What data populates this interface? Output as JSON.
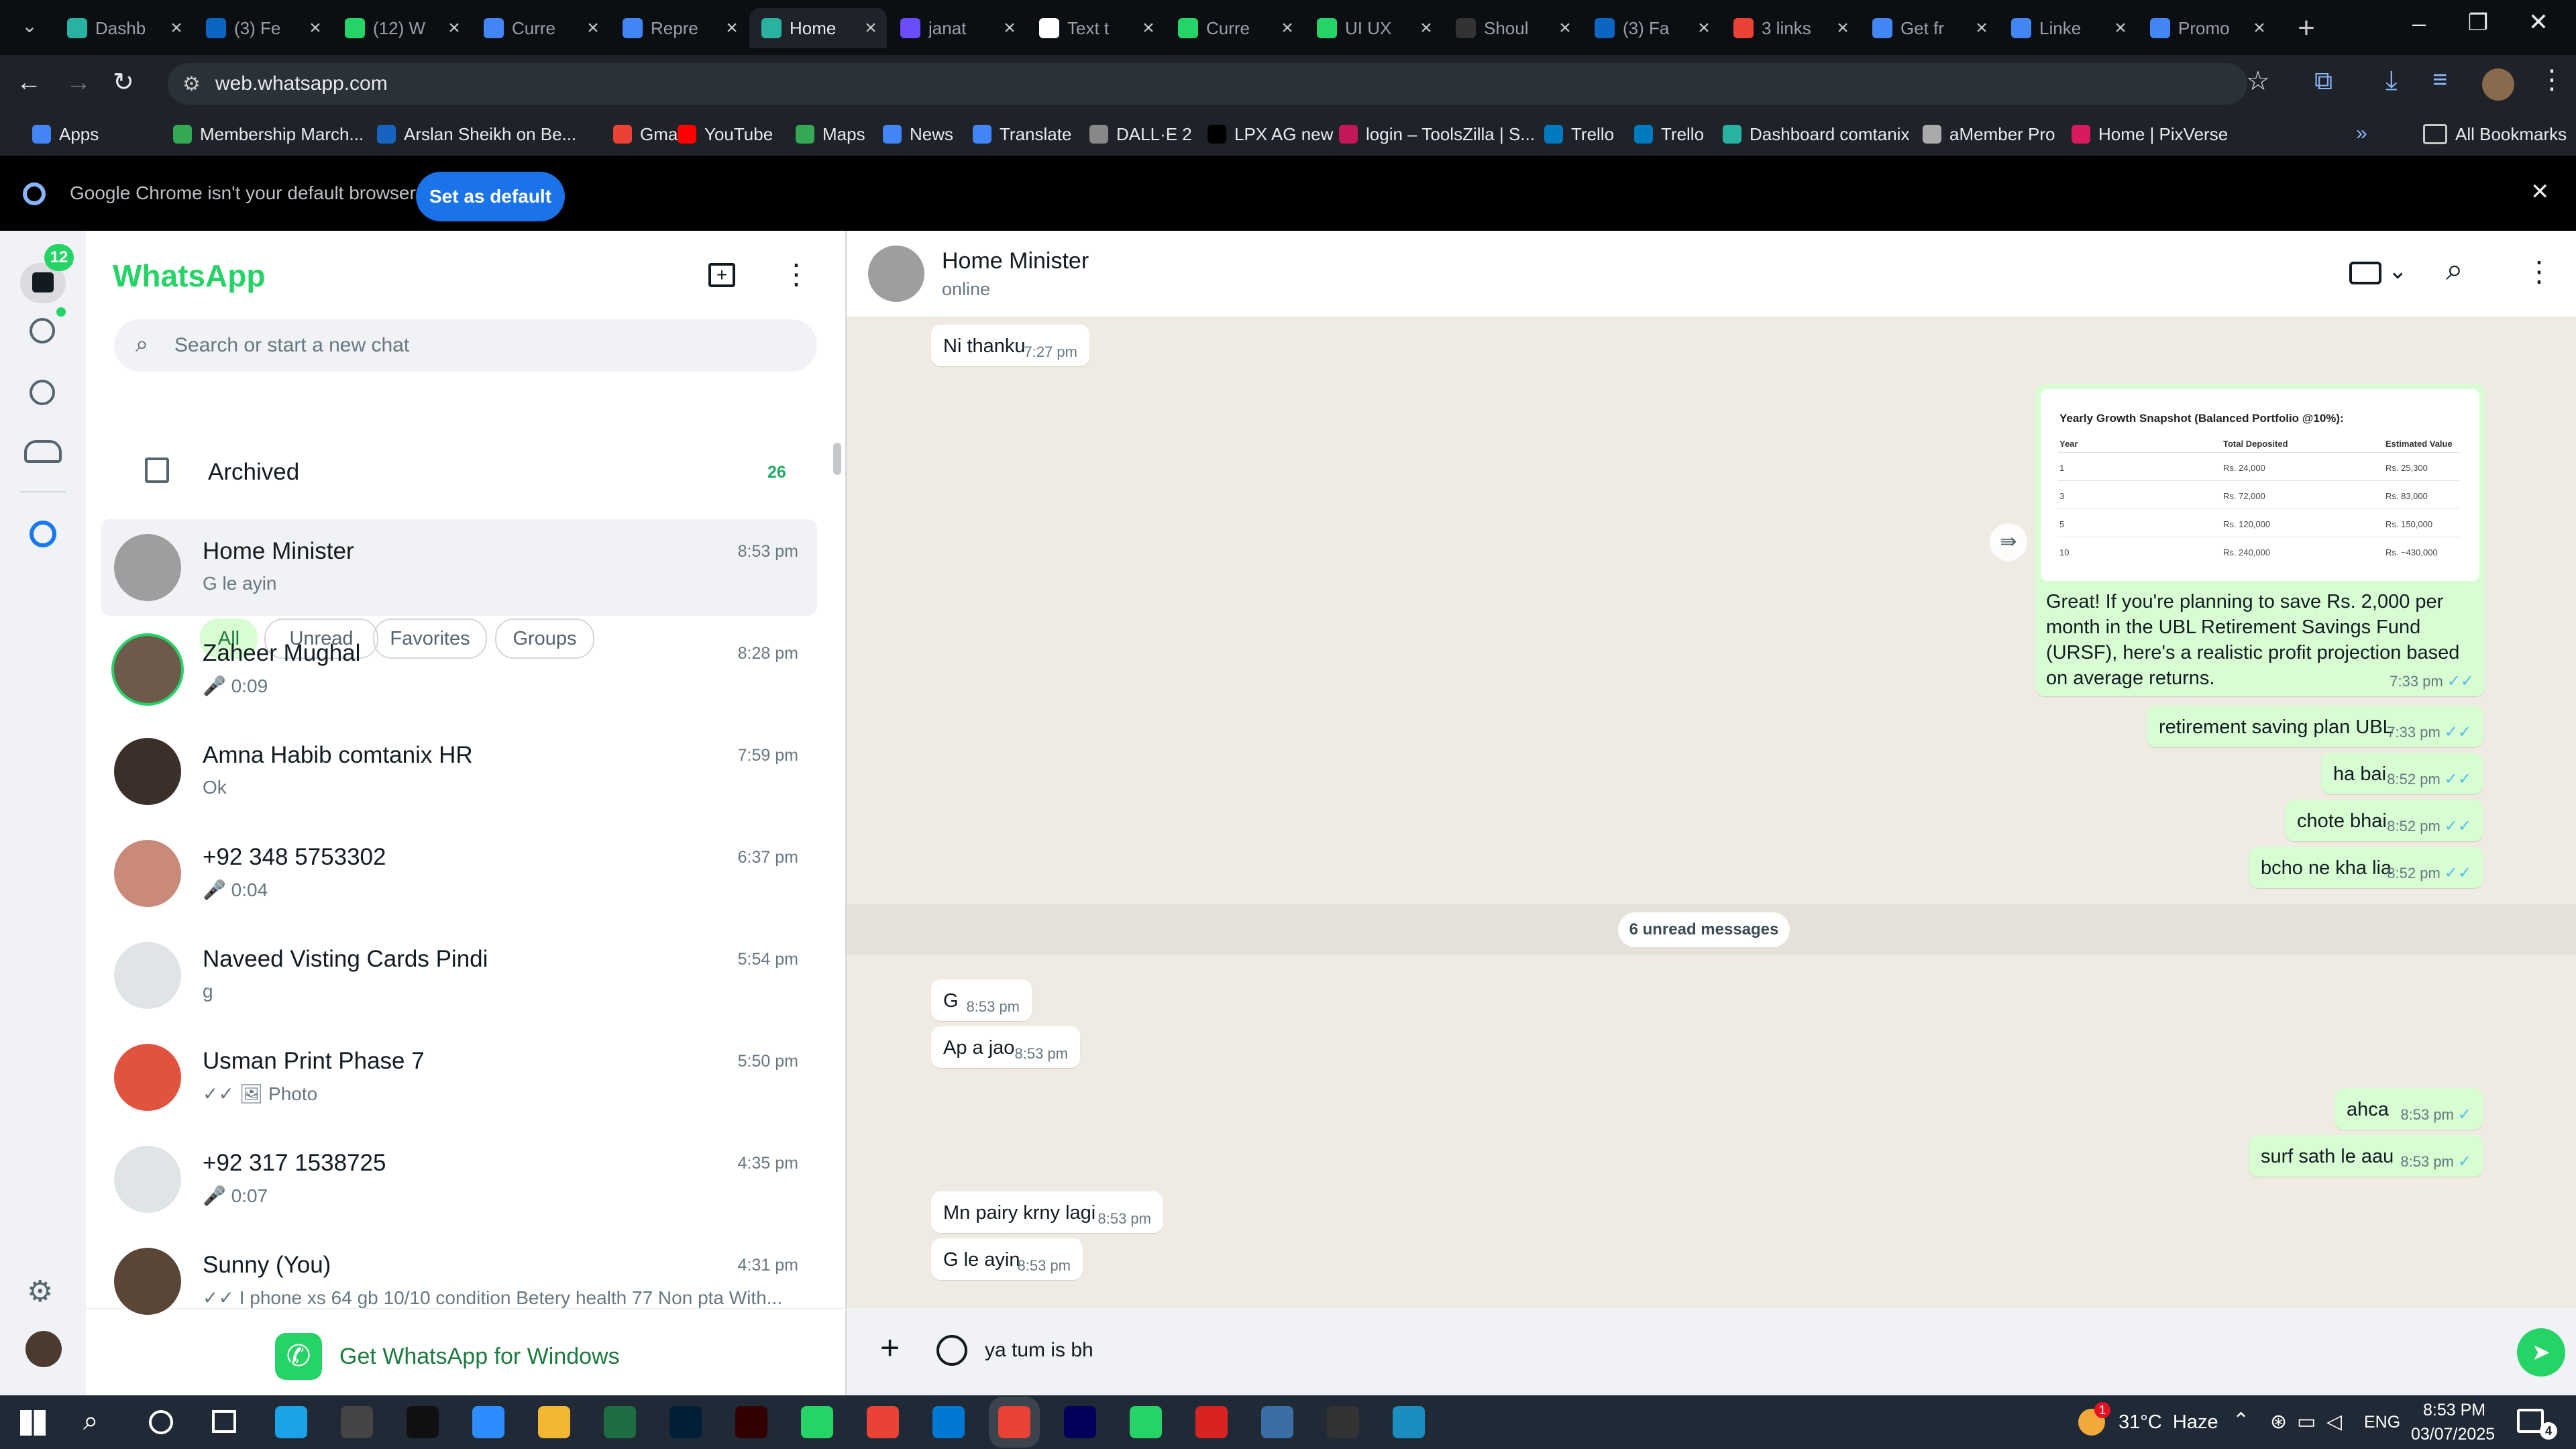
{
  "browser": {
    "tabs": [
      {
        "title": "Dashb",
        "color": "#2ab2a0"
      },
      {
        "title": "(3) Fe",
        "color": "#0a66c2"
      },
      {
        "title": "(12) W",
        "color": "#25d366"
      },
      {
        "title": "Curre",
        "color": "#4285f4"
      },
      {
        "title": "Repre",
        "color": "#4285f4"
      },
      {
        "title": "Home",
        "color": "#2ab2a0"
      },
      {
        "title": "janat",
        "color": "#6c4cff"
      },
      {
        "title": "Text t",
        "color": "#ffffff"
      },
      {
        "title": "Curre",
        "color": "#25d366"
      },
      {
        "title": "UI UX",
        "color": "#25d366"
      },
      {
        "title": "Shoul",
        "color": "#333333"
      },
      {
        "title": "(3) Fa",
        "color": "#0a66c2"
      },
      {
        "title": "3 links",
        "color": "#ea4335"
      },
      {
        "title": "Get fr",
        "color": "#4285f4"
      },
      {
        "title": "Linke",
        "color": "#4285f4"
      },
      {
        "title": "Promo",
        "color": "#4285f4"
      }
    ],
    "url": "web.whatsapp.com",
    "bookmarks": [
      {
        "label": "Apps",
        "color": "#4285f4"
      },
      {
        "label": "Membership March...",
        "color": "#34a853"
      },
      {
        "label": "Arslan Sheikh on Be...",
        "color": "#1565c0"
      },
      {
        "label": "Gmail",
        "color": "#ea4335"
      },
      {
        "label": "YouTube",
        "color": "#ff0000"
      },
      {
        "label": "Maps",
        "color": "#34a853"
      },
      {
        "label": "News",
        "color": "#4285f4"
      },
      {
        "label": "Translate",
        "color": "#4285f4"
      },
      {
        "label": "DALL·E 2",
        "color": "#888888"
      },
      {
        "label": "LPX AG new",
        "color": "#000000"
      },
      {
        "label": "login – ToolsZilla | S...",
        "color": "#c2185b"
      },
      {
        "label": "Trello",
        "color": "#0079bf"
      },
      {
        "label": "Trello",
        "color": "#0079bf"
      },
      {
        "label": "Dashboard comtanix",
        "color": "#2ab2a0"
      },
      {
        "label": "aMember Pro",
        "color": "#aaaaaa"
      },
      {
        "label": "Home | PixVerse",
        "color": "#d81b60"
      }
    ],
    "all_bookmarks": "All Bookmarks",
    "infobar_text": "Google Chrome isn't your default browser",
    "set_default": "Set as default"
  },
  "rail": {
    "badge": "12"
  },
  "sidebar": {
    "title": "WhatsApp",
    "search_placeholder": "Search or start a new chat",
    "filters": [
      "All",
      "Unread",
      "Favorites",
      "Groups"
    ],
    "archived_label": "Archived",
    "archived_count": "26",
    "chats": [
      {
        "name": "Home Minister",
        "preview": "G le ayin",
        "time": "8:53 pm",
        "avatar": "#9e9e9e"
      },
      {
        "name": "Zaheer Mughal",
        "preview": "🎤 0:09",
        "time": "8:28 pm",
        "avatar": "#6d5a4a"
      },
      {
        "name": "Amna Habib comtanix HR",
        "preview": "Ok",
        "time": "7:59 pm",
        "avatar": "#3b2f2a"
      },
      {
        "name": "+92 348 5753302",
        "preview": "🎤 0:04",
        "time": "6:37 pm",
        "avatar": "#c98a7a"
      },
      {
        "name": "Naveed Visting Cards Pindi",
        "preview": "g",
        "time": "5:54 pm",
        "avatar": "#dfe5e7"
      },
      {
        "name": "Usman Print Phase 7",
        "preview": "✓✓ 🖼 Photo",
        "time": "5:50 pm",
        "avatar": "#e0533e"
      },
      {
        "name": "+92 317 1538725",
        "preview": "🎤 0:07",
        "time": "4:35 pm",
        "avatar": "#dfe5e7"
      },
      {
        "name": "Sunny (You)",
        "preview": "✓✓ I phone xs  64 gb 10/10 condition Betery health 77 Non pta With...",
        "time": "4:31 pm",
        "avatar": "#5a4636"
      }
    ],
    "promo": "Get WhatsApp for Windows"
  },
  "conversation": {
    "contact_name": "Home Minister",
    "status": "online",
    "image_card": {
      "title": "Yearly Growth Snapshot (Balanced Portfolio @10%):",
      "headers": [
        "Year",
        "Total Deposited",
        "Estimated Value"
      ],
      "rows": [
        [
          "1",
          "Rs. 24,000",
          "Rs. 25,300"
        ],
        [
          "3",
          "Rs. 72,000",
          "Rs. 83,000"
        ],
        [
          "5",
          "Rs. 120,000",
          "Rs. 150,000"
        ],
        [
          "10",
          "Rs. 240,000",
          "Rs. ~430,000"
        ]
      ]
    },
    "messages": [
      {
        "dir": "in",
        "text": "Ni thanku",
        "time": "7:27 pm"
      },
      {
        "dir": "out",
        "text": "Great! If you're planning to save Rs. 2,000 per month in the UBL Retirement Savings Fund (URSF), here's a realistic profit projection based on average returns.",
        "time": "7:33 pm"
      },
      {
        "dir": "out",
        "text": "retirement saving plan UBL",
        "time": "7:33 pm"
      },
      {
        "dir": "out",
        "text": "ha bai",
        "time": "8:52 pm"
      },
      {
        "dir": "out",
        "text": "chote bhai",
        "time": "8:52 pm"
      },
      {
        "dir": "out",
        "text": "bcho ne kha lia",
        "time": "8:52 pm"
      },
      {
        "dir": "in",
        "text": "G",
        "time": "8:53 pm"
      },
      {
        "dir": "in",
        "text": "Ap a jao",
        "time": "8:53 pm"
      },
      {
        "dir": "out",
        "text": "ahca",
        "time": "8:53 pm"
      },
      {
        "dir": "out",
        "text": "surf sath le aau",
        "time": "8:53 pm"
      },
      {
        "dir": "in",
        "text": "Mn pairy krny lagi",
        "time": "8:53 pm"
      },
      {
        "dir": "in",
        "text": "G le ayin",
        "time": "8:53 pm"
      }
    ],
    "unread_divider": "6 unread messages",
    "composer_value": "ya tum is bh"
  },
  "taskbar": {
    "weather": "31°C  Haze",
    "weather_badge": "1",
    "lang": "ENG",
    "time": "8:53 PM",
    "date": "03/07/2025",
    "notif_count": "4",
    "apps": [
      {
        "name": "edge",
        "color": "#1aa3e8"
      },
      {
        "name": "pen",
        "color": "#444444"
      },
      {
        "name": "terminal",
        "color": "#111111"
      },
      {
        "name": "zoom",
        "color": "#2d8cff"
      },
      {
        "name": "explorer",
        "color": "#f2b632"
      },
      {
        "name": "excel",
        "color": "#1d6f42"
      },
      {
        "name": "photoshop",
        "color": "#001e36"
      },
      {
        "name": "illustrator",
        "color": "#330000"
      },
      {
        "name": "phone",
        "color": "#25d366"
      },
      {
        "name": "chrome",
        "color": "#ea4335"
      },
      {
        "name": "vscode",
        "color": "#0078d4"
      },
      {
        "name": "chrome-active",
        "color": "#ea4335"
      },
      {
        "name": "premiere",
        "color": "#00005b"
      },
      {
        "name": "phone2",
        "color": "#25d366"
      },
      {
        "name": "acrobat",
        "color": "#d92323"
      },
      {
        "name": "calculator",
        "color": "#3a6ea5"
      },
      {
        "name": "media",
        "color": "#333333"
      },
      {
        "name": "app",
        "color": "#1a8fbf"
      }
    ]
  },
  "colors": {
    "wa_green": "#25d366",
    "chip_active": "#d9fdd3",
    "tick_blue": "#53bdeb"
  }
}
